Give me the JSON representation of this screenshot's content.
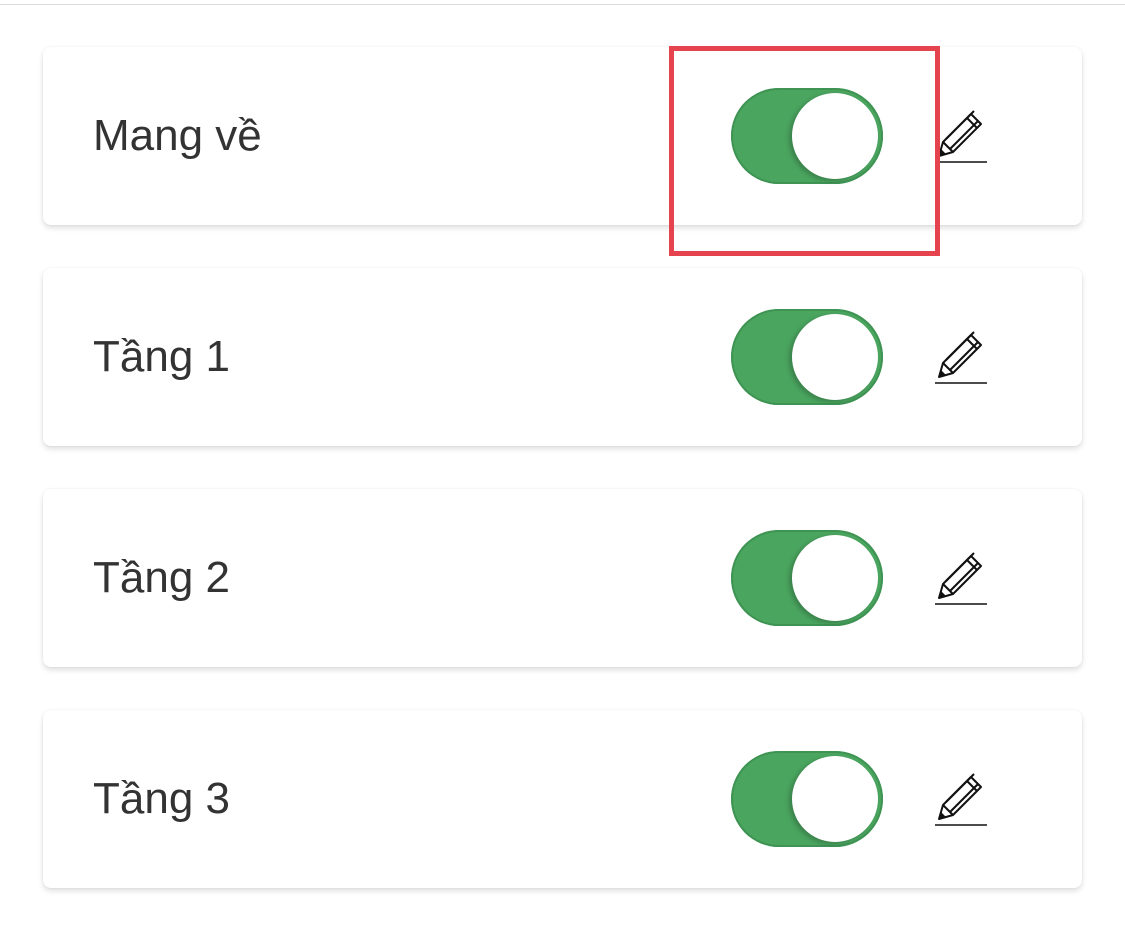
{
  "accent_color": "#4aa55f",
  "highlight_color": "#e5434e",
  "areas": [
    {
      "label": "Mang về",
      "enabled": true,
      "edit_icon": "pencil-icon"
    },
    {
      "label": "Tầng 1",
      "enabled": true,
      "edit_icon": "pencil-icon"
    },
    {
      "label": "Tầng 2",
      "enabled": true,
      "edit_icon": "pencil-icon"
    },
    {
      "label": "Tầng 3",
      "enabled": true,
      "edit_icon": "pencil-icon"
    }
  ]
}
